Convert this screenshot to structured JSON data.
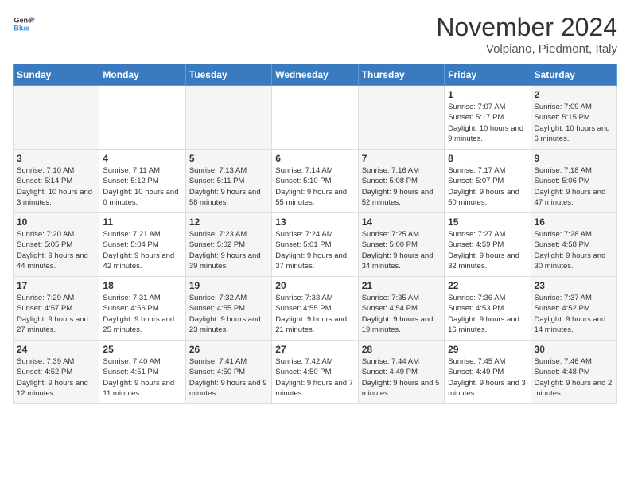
{
  "logo": {
    "line1": "General",
    "line2": "Blue"
  },
  "title": "November 2024",
  "subtitle": "Volpiano, Piedmont, Italy",
  "weekdays": [
    "Sunday",
    "Monday",
    "Tuesday",
    "Wednesday",
    "Thursday",
    "Friday",
    "Saturday"
  ],
  "weeks": [
    [
      {
        "day": "",
        "info": ""
      },
      {
        "day": "",
        "info": ""
      },
      {
        "day": "",
        "info": ""
      },
      {
        "day": "",
        "info": ""
      },
      {
        "day": "",
        "info": ""
      },
      {
        "day": "1",
        "info": "Sunrise: 7:07 AM\nSunset: 5:17 PM\nDaylight: 10 hours and 9 minutes."
      },
      {
        "day": "2",
        "info": "Sunrise: 7:09 AM\nSunset: 5:15 PM\nDaylight: 10 hours and 6 minutes."
      }
    ],
    [
      {
        "day": "3",
        "info": "Sunrise: 7:10 AM\nSunset: 5:14 PM\nDaylight: 10 hours and 3 minutes."
      },
      {
        "day": "4",
        "info": "Sunrise: 7:11 AM\nSunset: 5:12 PM\nDaylight: 10 hours and 0 minutes."
      },
      {
        "day": "5",
        "info": "Sunrise: 7:13 AM\nSunset: 5:11 PM\nDaylight: 9 hours and 58 minutes."
      },
      {
        "day": "6",
        "info": "Sunrise: 7:14 AM\nSunset: 5:10 PM\nDaylight: 9 hours and 55 minutes."
      },
      {
        "day": "7",
        "info": "Sunrise: 7:16 AM\nSunset: 5:08 PM\nDaylight: 9 hours and 52 minutes."
      },
      {
        "day": "8",
        "info": "Sunrise: 7:17 AM\nSunset: 5:07 PM\nDaylight: 9 hours and 50 minutes."
      },
      {
        "day": "9",
        "info": "Sunrise: 7:18 AM\nSunset: 5:06 PM\nDaylight: 9 hours and 47 minutes."
      }
    ],
    [
      {
        "day": "10",
        "info": "Sunrise: 7:20 AM\nSunset: 5:05 PM\nDaylight: 9 hours and 44 minutes."
      },
      {
        "day": "11",
        "info": "Sunrise: 7:21 AM\nSunset: 5:04 PM\nDaylight: 9 hours and 42 minutes."
      },
      {
        "day": "12",
        "info": "Sunrise: 7:23 AM\nSunset: 5:02 PM\nDaylight: 9 hours and 39 minutes."
      },
      {
        "day": "13",
        "info": "Sunrise: 7:24 AM\nSunset: 5:01 PM\nDaylight: 9 hours and 37 minutes."
      },
      {
        "day": "14",
        "info": "Sunrise: 7:25 AM\nSunset: 5:00 PM\nDaylight: 9 hours and 34 minutes."
      },
      {
        "day": "15",
        "info": "Sunrise: 7:27 AM\nSunset: 4:59 PM\nDaylight: 9 hours and 32 minutes."
      },
      {
        "day": "16",
        "info": "Sunrise: 7:28 AM\nSunset: 4:58 PM\nDaylight: 9 hours and 30 minutes."
      }
    ],
    [
      {
        "day": "17",
        "info": "Sunrise: 7:29 AM\nSunset: 4:57 PM\nDaylight: 9 hours and 27 minutes."
      },
      {
        "day": "18",
        "info": "Sunrise: 7:31 AM\nSunset: 4:56 PM\nDaylight: 9 hours and 25 minutes."
      },
      {
        "day": "19",
        "info": "Sunrise: 7:32 AM\nSunset: 4:55 PM\nDaylight: 9 hours and 23 minutes."
      },
      {
        "day": "20",
        "info": "Sunrise: 7:33 AM\nSunset: 4:55 PM\nDaylight: 9 hours and 21 minutes."
      },
      {
        "day": "21",
        "info": "Sunrise: 7:35 AM\nSunset: 4:54 PM\nDaylight: 9 hours and 19 minutes."
      },
      {
        "day": "22",
        "info": "Sunrise: 7:36 AM\nSunset: 4:53 PM\nDaylight: 9 hours and 16 minutes."
      },
      {
        "day": "23",
        "info": "Sunrise: 7:37 AM\nSunset: 4:52 PM\nDaylight: 9 hours and 14 minutes."
      }
    ],
    [
      {
        "day": "24",
        "info": "Sunrise: 7:39 AM\nSunset: 4:52 PM\nDaylight: 9 hours and 12 minutes."
      },
      {
        "day": "25",
        "info": "Sunrise: 7:40 AM\nSunset: 4:51 PM\nDaylight: 9 hours and 11 minutes."
      },
      {
        "day": "26",
        "info": "Sunrise: 7:41 AM\nSunset: 4:50 PM\nDaylight: 9 hours and 9 minutes."
      },
      {
        "day": "27",
        "info": "Sunrise: 7:42 AM\nSunset: 4:50 PM\nDaylight: 9 hours and 7 minutes."
      },
      {
        "day": "28",
        "info": "Sunrise: 7:44 AM\nSunset: 4:49 PM\nDaylight: 9 hours and 5 minutes."
      },
      {
        "day": "29",
        "info": "Sunrise: 7:45 AM\nSunset: 4:49 PM\nDaylight: 9 hours and 3 minutes."
      },
      {
        "day": "30",
        "info": "Sunrise: 7:46 AM\nSunset: 4:48 PM\nDaylight: 9 hours and 2 minutes."
      }
    ]
  ]
}
